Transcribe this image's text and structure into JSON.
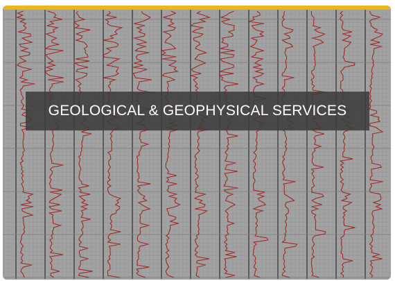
{
  "card": {
    "title": "GEOLOGICAL & GEOPHYSICAL SERVICES",
    "image_icon": "well-log-image",
    "accent_color": "#f2b41b",
    "overlay_color": "#3c3c3c",
    "trace_color": "#a01a1a",
    "background_color": "#9e9e9e"
  }
}
